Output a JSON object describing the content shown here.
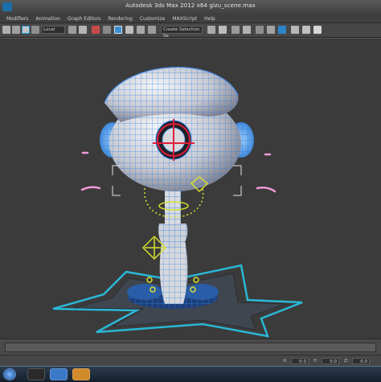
{
  "window": {
    "title": "Autodesk 3ds Max 2012 x64     gizu_scene.max"
  },
  "menu": {
    "items": [
      "Modifiers",
      "Animation",
      "Graph Editors",
      "Rendering",
      "Customize",
      "MAXScript",
      "Help"
    ]
  },
  "toolbar": {
    "reference_coord": "Local",
    "selection_set": "Create Selection Se"
  },
  "status": {
    "x_label": "X:",
    "x_value": "0.0",
    "y_label": "Y:",
    "y_value": "0.0",
    "z_label": "Z:",
    "z_value": "0.0"
  },
  "icons": {
    "app": "3ds-max-app-icon",
    "taskbar": [
      "windows-start-icon",
      "3ds-max-taskbar-icon",
      "explorer-taskbar-icon",
      "browser-taskbar-icon"
    ]
  },
  "colors": {
    "wireframe": "#2f7fe0",
    "gizmo_red": "#e01e3c",
    "star_outline": "#2ab7d6",
    "rig_green": "#d7e12e",
    "rig_pink": "#f29ad8"
  }
}
